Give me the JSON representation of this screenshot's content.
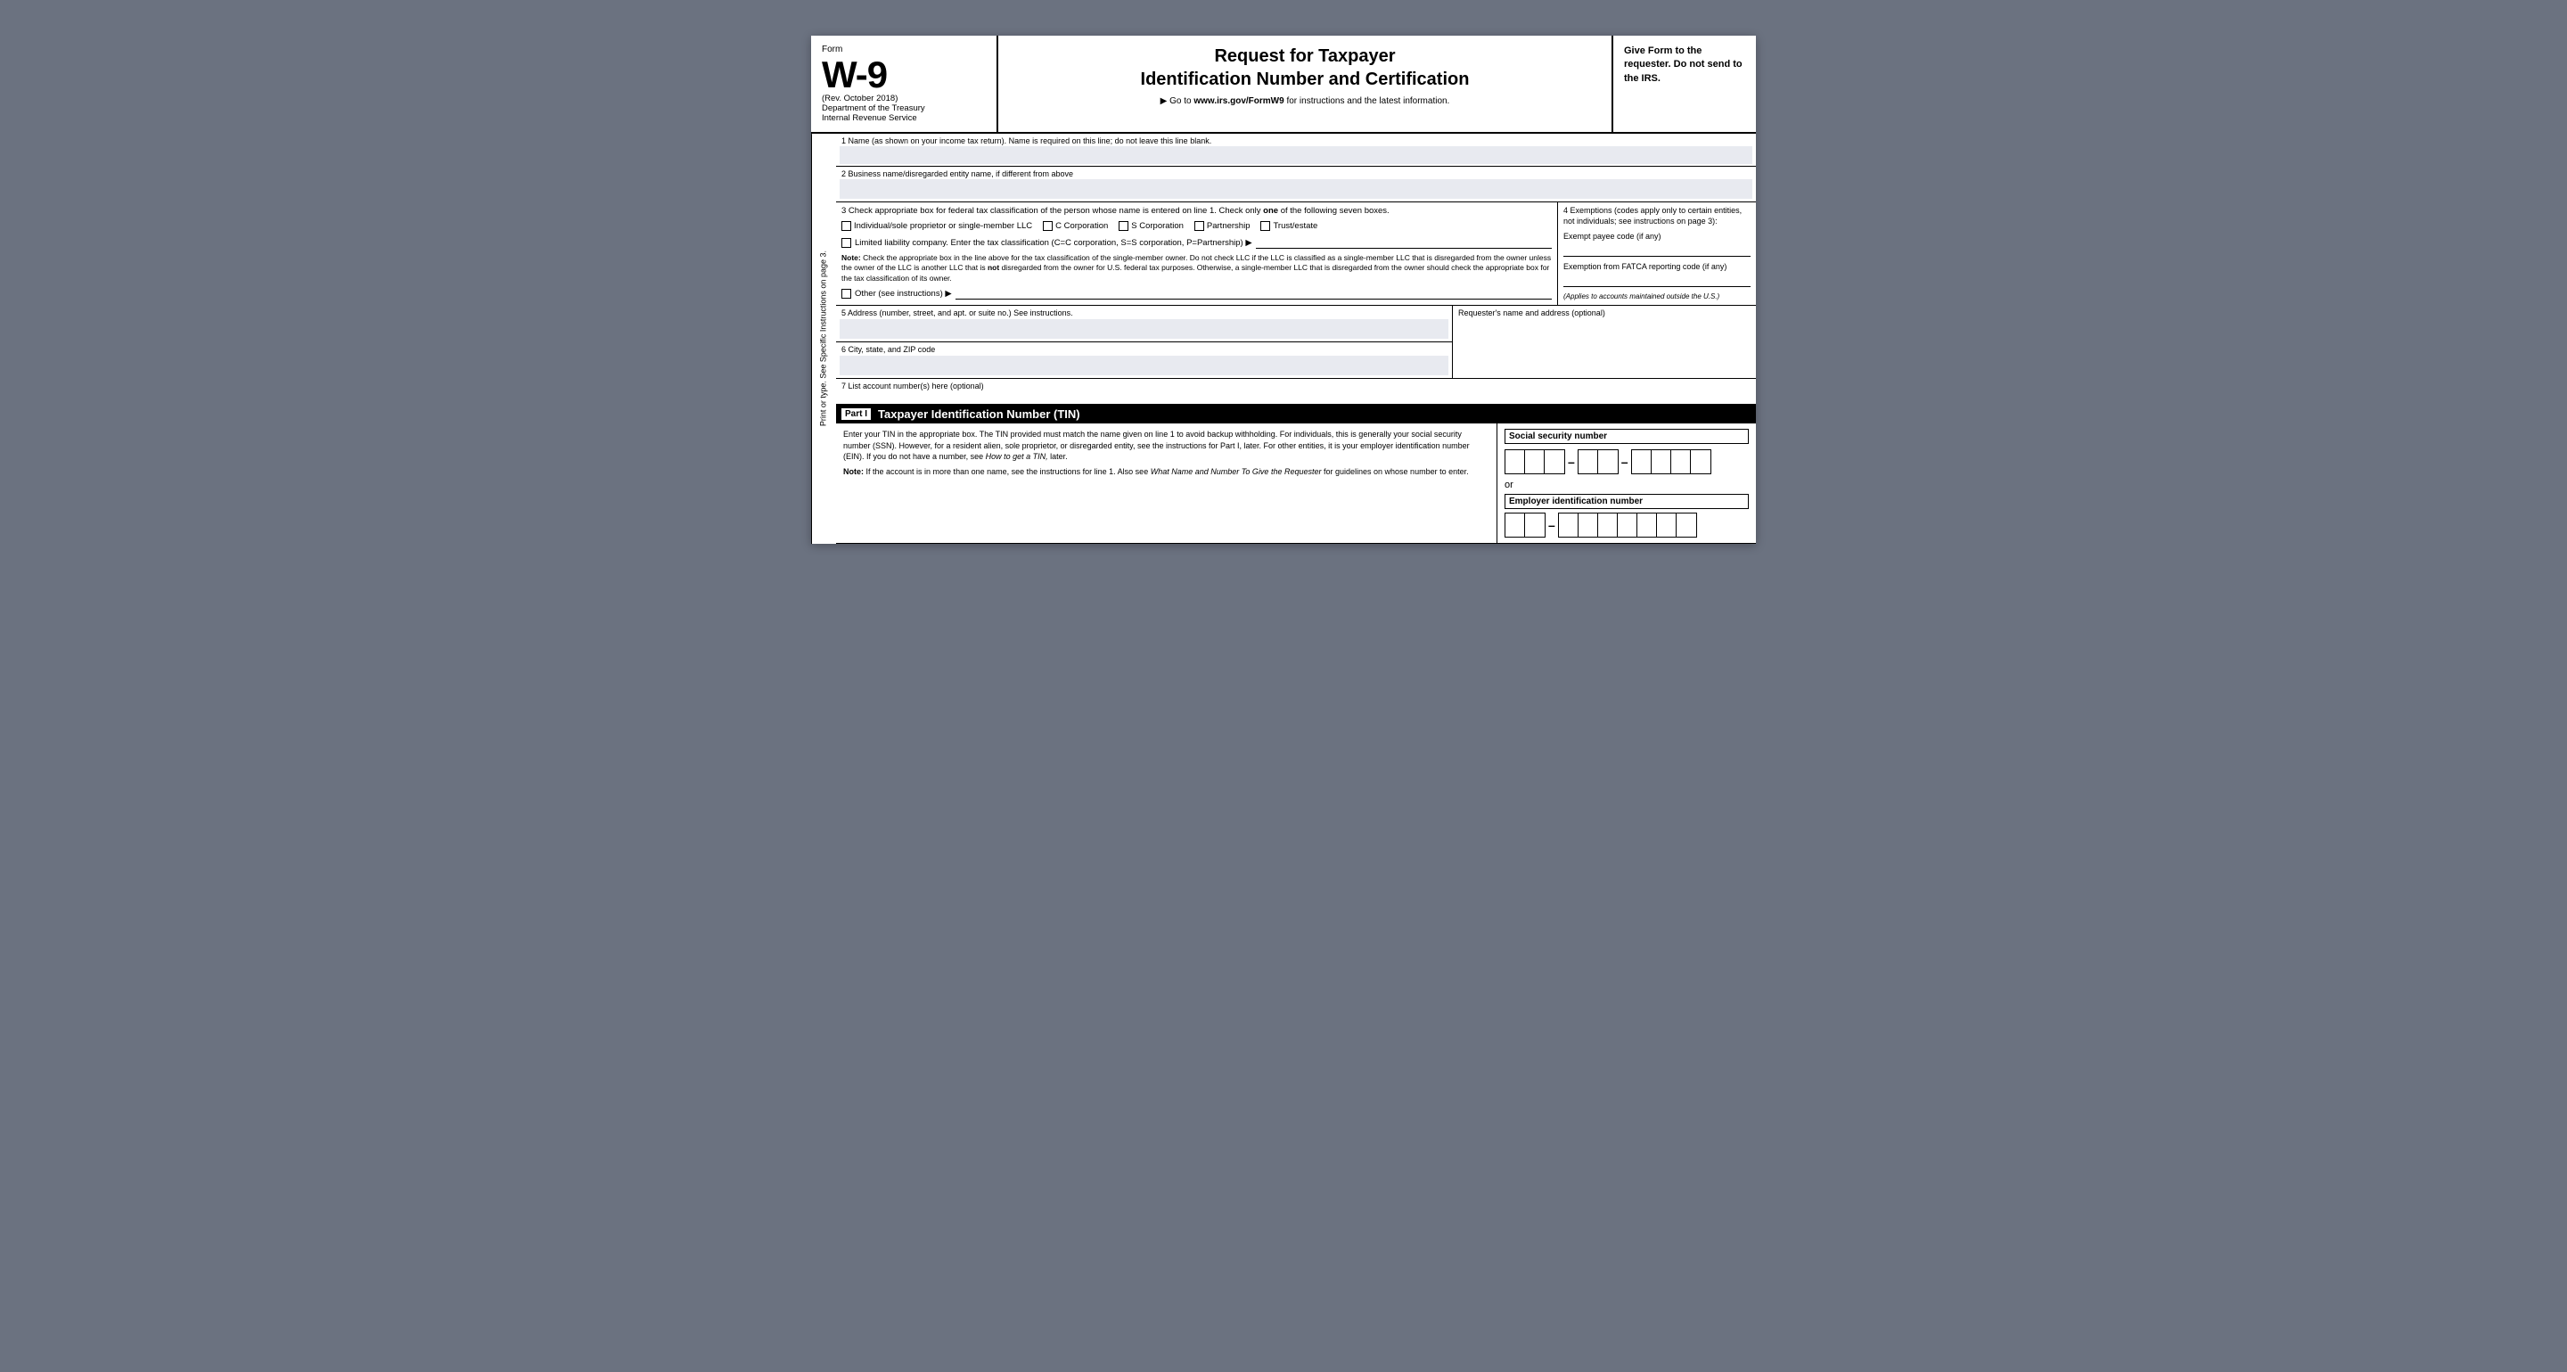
{
  "header": {
    "form_word": "Form",
    "form_number": "W-9",
    "rev": "(Rev. October 2018)",
    "dept": "Department of the Treasury",
    "irs": "Internal Revenue Service",
    "title_line1": "Request for Taxpayer",
    "title_line2": "Identification Number and Certification",
    "go_to": "▶ Go to",
    "go_to_url": "www.irs.gov/FormW9",
    "go_to_rest": "for instructions and the latest information.",
    "right_text": "Give Form to the requester. Do not send to the IRS."
  },
  "side": {
    "text": "Print or type.     See Specific Instructions on page 3."
  },
  "line1": {
    "label": "1  Name (as shown on your income tax return). Name is required on this line; do not leave this line blank."
  },
  "line2": {
    "label": "2  Business name/disregarded entity name, if different from above"
  },
  "line3": {
    "label_start": "3  Check appropriate box for federal tax classification of the person whose name is entered on line 1. Check only",
    "label_bold": "one",
    "label_end": "of the following seven boxes.",
    "individual_label": "Individual/sole proprietor or single-member LLC",
    "c_corp_label": "C Corporation",
    "s_corp_label": "S Corporation",
    "partnership_label": "Partnership",
    "trust_label": "Trust/estate",
    "llc_label": "Limited liability company. Enter the tax classification (C=C corporation, S=S corporation, P=Partnership) ▶",
    "note_label": "Note:",
    "note_text": " Check the appropriate box in the line above for the tax classification of the single-member owner.  Do not check LLC if the LLC is classified as a single-member LLC that is disregarded from the owner unless the owner of the LLC is another LLC that is",
    "note_not": "not",
    "note_text2": " disregarded from the owner for U.S. federal tax purposes. Otherwise, a single-member LLC that is disregarded from the owner should check the appropriate box for the tax classification of its owner.",
    "other_label": "Other (see instructions) ▶"
  },
  "exemptions": {
    "title": "4  Exemptions (codes apply only to certain entities, not individuals; see instructions on page 3):",
    "exempt_payee_label": "Exempt payee code (if any)",
    "fatca_label": "Exemption from FATCA reporting code (if any)",
    "applies_note": "(Applies to accounts maintained outside the U.S.)"
  },
  "line5": {
    "label": "5  Address (number, street, and apt. or suite no.) See instructions."
  },
  "line6": {
    "label": "6  City, state, and ZIP code"
  },
  "requester": {
    "label": "Requester's name and address (optional)"
  },
  "line7": {
    "label": "7  List account number(s) here (optional)"
  },
  "part1": {
    "part_label": "Part I",
    "title": "Taxpayer Identification Number (TIN)",
    "body_text": "Enter your TIN in the appropriate box. The TIN provided must match the name given on line 1 to avoid backup withholding. For individuals, this is generally your social security number (SSN). However, for a resident alien, sole proprietor, or disregarded entity, see the instructions for Part I, later. For other entities, it is your employer identification number (EIN). If you do not have a number, see",
    "how_to_italic": "How to get a TIN,",
    "body_text2": " later.",
    "note_label": "Note:",
    "note_body": " If the account is in more than one name, see the instructions for line 1. Also see",
    "what_name_italic": "What Name and Number To Give the Requester",
    "note_body2": " for guidelines on whose number to enter.",
    "ssn_label": "Social security number",
    "ssn_group1_cells": 3,
    "ssn_group2_cells": 2,
    "ssn_group3_cells": 4,
    "or_text": "or",
    "ein_label": "Employer identification number",
    "ein_group1_cells": 2,
    "ein_group2_cells": 7
  }
}
